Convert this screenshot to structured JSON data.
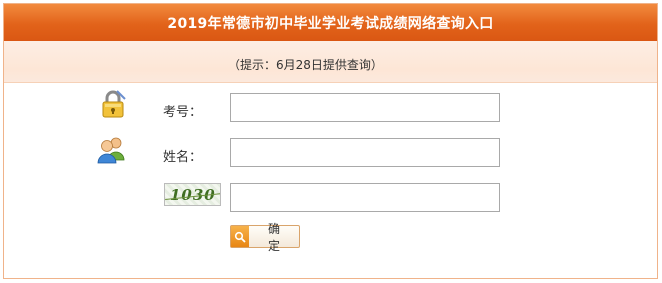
{
  "header": {
    "title": "2019年常德市初中毕业学业考试成绩网络查询入口"
  },
  "hint": {
    "text": "（提示：6月28日提供查询）"
  },
  "form": {
    "exam_number": {
      "label": "考号：",
      "value": "",
      "icon": "padlock-icon"
    },
    "name": {
      "label": "姓名：",
      "value": "",
      "icon": "users-icon"
    },
    "captcha": {
      "image_text": "1030",
      "value": ""
    },
    "submit": {
      "label": "确 定",
      "icon": "search-icon"
    }
  },
  "colors": {
    "header_bg": "#e2631a",
    "hint_bg": "#fde6d6",
    "border": "#f0b38a"
  }
}
